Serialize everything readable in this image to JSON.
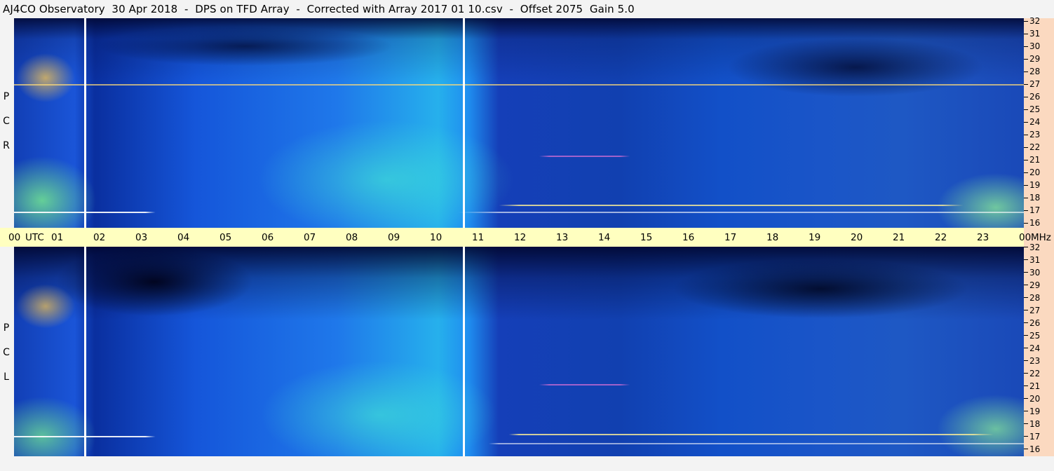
{
  "title": "AJ4CO Observatory  30 Apr 2018  -  DPS on TFD Array  -  Corrected with Array 2017 01 10.csv  -  Offset 2075  Gain 5.0",
  "panels": [
    {
      "id": "top",
      "polarization_letters": [
        "R",
        "C",
        "P"
      ]
    },
    {
      "id": "bottom",
      "polarization_letters": [
        "L",
        "C",
        "P"
      ]
    }
  ],
  "time_axis": {
    "labels": [
      "00",
      "UTC",
      "01",
      "02",
      "03",
      "04",
      "05",
      "06",
      "07",
      "08",
      "09",
      "10",
      "11",
      "12",
      "13",
      "14",
      "15",
      "16",
      "17",
      "18",
      "19",
      "20",
      "21",
      "22",
      "23",
      "00",
      "MHz"
    ]
  },
  "freq_axis": {
    "top_labels": [
      "32",
      "31",
      "30",
      "29",
      "28",
      "27",
      "26",
      "25",
      "24",
      "23",
      "22",
      "21",
      "20",
      "19",
      "18",
      "17",
      "16"
    ],
    "bottom_labels": [
      "32",
      "31",
      "30",
      "29",
      "28",
      "27",
      "26",
      "25",
      "24",
      "23",
      "22",
      "21",
      "20",
      "19",
      "18",
      "17",
      "16"
    ]
  },
  "colors": {
    "background": "#f3f3f3",
    "timebar": "#ffffc0",
    "freq_scale": "#fbd9c0",
    "spectrogram_dark": "#000a3c",
    "spectrogram_blue": "#1f6fe8",
    "spectrogram_cyan": "#22d8e0",
    "spectrogram_green": "#7cf0a0",
    "spectrogram_hot": "#ffe060"
  }
}
